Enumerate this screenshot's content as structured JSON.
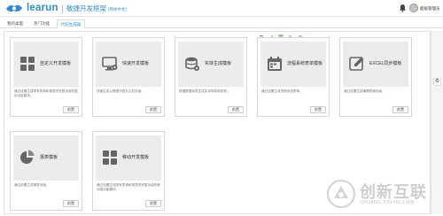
{
  "header": {
    "brand": "learun",
    "product": "敏捷开发框架",
    "product_sub": "[简体中文]",
    "user_name": "超级管理员"
  },
  "tabs": [
    {
      "label": "我的桌面",
      "active": false
    },
    {
      "label": "热门功能",
      "active": false
    },
    {
      "label": "代码生成器",
      "active": true
    }
  ],
  "cards": [
    {
      "title": "自定义开发模板",
      "icon": "grid-tiles-icon",
      "desc": "通过设置生成带有表单和报表的完整功能的复杂功能模块。",
      "button": "前置"
    },
    {
      "title": "快速开发模板",
      "icon": "monitor-gear-icon",
      "desc": "快速生成以数据列表为主的页面。",
      "button": "前置"
    },
    {
      "title": "实体生成模板",
      "icon": "database-gear-icon",
      "desc": "根据数据库表生成实体类和映射类。",
      "button": "前置"
    },
    {
      "title": "流程系统表单模板",
      "icon": "calendar-form-icon",
      "desc": "通过设置生成流程系统表单。",
      "button": "前置"
    },
    {
      "title": "EXCEL同步模板",
      "icon": "pencil-edit-icon",
      "desc": "通过设置生成编辑表格页面。",
      "button": "前置"
    },
    {
      "title": "报表模板",
      "icon": "pie-chart-icon",
      "desc": "通过设置生成报表页面。",
      "button": "前置"
    },
    {
      "title": "移动开发模板",
      "icon": "grid-tiles-icon",
      "desc": "通过设置生成带有表单和报表的完整功能的移动端功能模块。",
      "button": "前置"
    }
  ],
  "watermark": {
    "text": "创新互联",
    "sub": "CHUANG XIN HU LIAN"
  },
  "colors": {
    "brand": "#2d8cd8",
    "card_hero": "#ececec",
    "toolbar_green": "#5aa84b"
  }
}
